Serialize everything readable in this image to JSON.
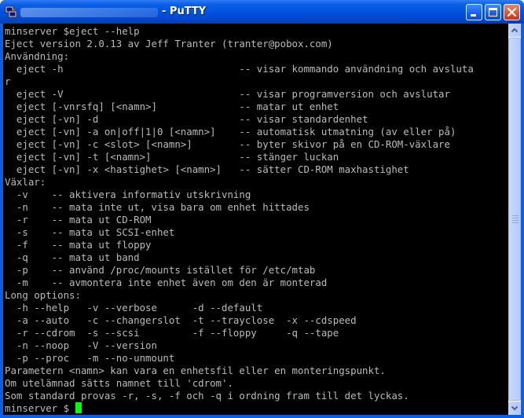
{
  "window": {
    "title": "- PuTTY",
    "accent": "#0a5fe6"
  },
  "terminal": {
    "background": "#000000",
    "foreground": "#bbbbbb",
    "cursor_color": "#00ff00",
    "lines": [
      "minserver $eject --help",
      "Eject version 2.0.13 av Jeff Tranter (tranter@pobox.com)",
      "Användning:",
      "  eject -h                              -- visar kommando användning och avsluta",
      "r",
      "  eject -V                              -- visar programversion och avslutar",
      "  eject [-vnrsfq] [<namn>]              -- matar ut enhet",
      "  eject [-vn] -d                        -- visar standardenhet",
      "  eject [-vn] -a on|off|1|0 [<namn>]    -- automatisk utmatning (av eller på)",
      "  eject [-vn] -c <slot> [<namn>]        -- byter skivor på en CD-ROM-växlare",
      "  eject [-vn] -t [<namn>]               -- stänger luckan",
      "  eject [-vn] -x <hastighet> [<namn>]   -- sätter CD-ROM maxhastighet",
      "Växlar:",
      "  -v    -- aktivera informativ utskrivning",
      "  -n    -- mata inte ut, visa bara om enhet hittades",
      "  -r    -- mata ut CD-ROM",
      "  -s    -- mata ut SCSI-enhet",
      "  -f    -- mata ut floppy",
      "  -q    -- mata ut band",
      "  -p    -- använd /proc/mounts istället för /etc/mtab",
      "  -m    -- avmontera inte enhet även om den är monterad",
      "Long options:",
      "  -h --help   -v --verbose      -d --default",
      "  -a --auto   -c --changerslot  -t --trayclose  -x --cdspeed",
      "  -r --cdrom  -s --scsi         -f --floppy     -q --tape",
      "  -n --noop   -V --version",
      "  -p --proc   -m --no-unmount",
      "Parametern <namn> kan vara en enhetsfil eller en monteringspunkt.",
      "Om utelämnad sätts namnet till 'cdrom'.",
      "Som standard provas -r, -s, -f och -q i ordning fram till det lyckas."
    ],
    "prompt": "minserver $"
  },
  "icons": {
    "app": "putty-icon",
    "minimize": "minimize-icon",
    "maximize": "maximize-icon",
    "close": "close-icon",
    "scroll_up": "arrow-up-icon",
    "scroll_down": "arrow-down-icon"
  }
}
